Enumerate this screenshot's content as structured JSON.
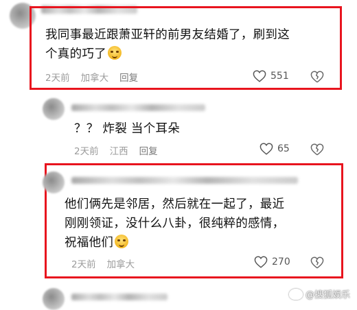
{
  "comments": [
    {
      "text_line1": "我同事最近跟萧亚轩的前男友结婚了，刷到这",
      "text_line2": "个真的巧了",
      "time": "2天前",
      "location": "加拿大",
      "reply_label": "回复",
      "likes": "551",
      "highlighted": true
    },
    {
      "text_line1": "？？ 炸裂 当个耳朵",
      "time": "2天前",
      "location": "江西",
      "reply_label": "回复",
      "likes": "65",
      "highlighted": false
    },
    {
      "text_line1": "他们俩先是邻居，然后就在一起了，最近",
      "text_line2": "刚刚领证，没什么八卦，很纯粹的感情，",
      "text_line3": "祝福他们",
      "time": "2天前",
      "location": "加拿大",
      "reply_label": "回复",
      "likes": "270",
      "highlighted": true
    }
  ],
  "watermark": "@搜狐娱乐",
  "colors": {
    "highlight_border": "#e8141e",
    "meta_text": "#9b9b9b"
  }
}
